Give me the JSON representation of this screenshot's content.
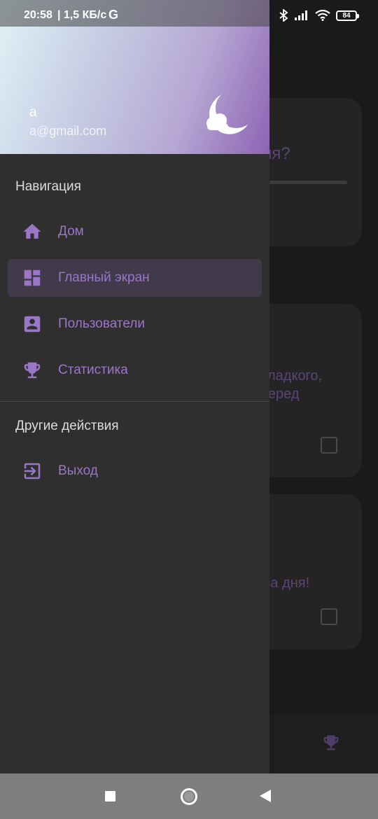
{
  "status_bar": {
    "time": "20:58",
    "network_speed": "| 1,5 КБ/с",
    "g_label": "G",
    "battery": "84"
  },
  "drawer": {
    "header": {
      "user_name": "a",
      "user_email": "a@gmail.com",
      "gradient_colors": [
        "#dff3f6",
        "#b5a6d3",
        "#8d63b3"
      ]
    },
    "sections": [
      {
        "title": "Навигация",
        "items": [
          {
            "label": "Дом",
            "icon": "home-icon",
            "selected": false
          },
          {
            "label": "Главный экран",
            "icon": "dashboard-icon",
            "selected": true
          },
          {
            "label": "Пользователи",
            "icon": "account-box-icon",
            "selected": false
          },
          {
            "label": "Статистика",
            "icon": "trophy-icon",
            "selected": false
          }
        ]
      },
      {
        "title": "Другие действия",
        "items": [
          {
            "label": "Выход",
            "icon": "logout-icon",
            "selected": false
          }
        ]
      }
    ],
    "accent_color": "#9a76c6"
  },
  "background": {
    "card1_text": "ия?",
    "card2_line1": "сладкого,",
    "card2_line2": "перед",
    "card3_text": "ва дня!"
  }
}
